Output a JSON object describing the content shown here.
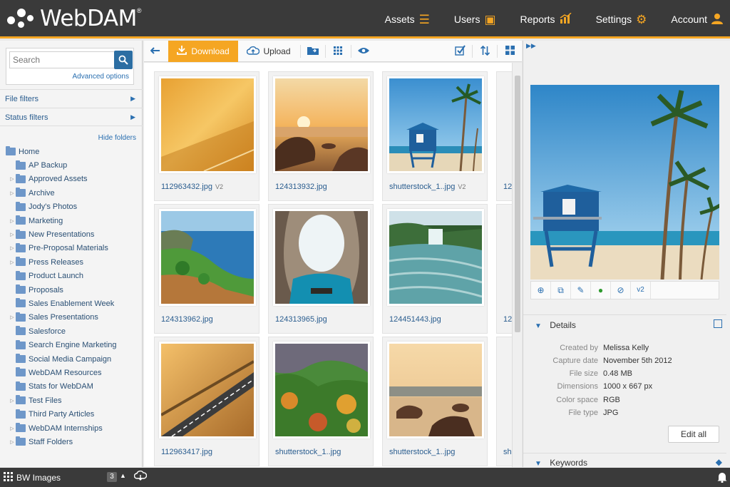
{
  "app": {
    "logo_text": "WebDAM",
    "logo_reg": "®"
  },
  "nav": [
    {
      "label": "Assets",
      "icon": "stack-icon"
    },
    {
      "label": "Users",
      "icon": "contact-card-icon"
    },
    {
      "label": "Reports",
      "icon": "chart-icon"
    },
    {
      "label": "Settings",
      "icon": "gears-icon"
    },
    {
      "label": "Account",
      "icon": "user-icon"
    }
  ],
  "search": {
    "placeholder": "Search",
    "advanced_label": "Advanced options"
  },
  "filters": {
    "file_filters": "File filters",
    "status_filters": "Status filters",
    "hide_folders": "Hide folders"
  },
  "folders": {
    "home": "Home",
    "items": [
      {
        "label": "AP Backup",
        "expandable": false
      },
      {
        "label": "Approved Assets",
        "expandable": true
      },
      {
        "label": "Archive",
        "expandable": true
      },
      {
        "label": "Jody's Photos",
        "expandable": false
      },
      {
        "label": "Marketing",
        "expandable": true
      },
      {
        "label": "New Presentations",
        "expandable": true
      },
      {
        "label": "Pre-Proposal Materials",
        "expandable": true
      },
      {
        "label": "Press Releases",
        "expandable": true
      },
      {
        "label": "Product Launch",
        "expandable": false
      },
      {
        "label": "Proposals",
        "expandable": false
      },
      {
        "label": "Sales Enablement Week",
        "expandable": false
      },
      {
        "label": "Sales Presentations",
        "expandable": true
      },
      {
        "label": "Salesforce",
        "expandable": false
      },
      {
        "label": "Search Engine Marketing",
        "expandable": false
      },
      {
        "label": "Social Media Campaign",
        "expandable": false
      },
      {
        "label": "WebDAM Resources",
        "expandable": false
      },
      {
        "label": "Stats for WebDAM",
        "expandable": false
      },
      {
        "label": "Test Files",
        "expandable": true
      },
      {
        "label": "Third Party Articles",
        "expandable": false
      },
      {
        "label": "WebDAM Internships",
        "expandable": true
      },
      {
        "label": "Staff Folders",
        "expandable": true
      }
    ]
  },
  "toolbar": {
    "download_label": "Download",
    "upload_label": "Upload"
  },
  "assets": [
    {
      "name": "112963432.jpg",
      "version": "V2",
      "scene": "haze"
    },
    {
      "name": "124313932.jpg",
      "version": "",
      "scene": "rocks-sunset"
    },
    {
      "name": "shutterstock_1..jpg",
      "version": "V2",
      "scene": "lifeguard"
    },
    {
      "name": "124313962.jpg",
      "version": "",
      "scene": "coast"
    },
    {
      "name": "124313965.jpg",
      "version": "",
      "scene": "cave"
    },
    {
      "name": "124451443.jpg",
      "version": "",
      "scene": "river"
    },
    {
      "name": "112963417.jpg",
      "version": "",
      "scene": "road"
    },
    {
      "name": "shutterstock_1..jpg",
      "version": "",
      "scene": "valley"
    },
    {
      "name": "shutterstock_1..jpg",
      "version": "",
      "scene": "rocks-sea"
    }
  ],
  "partial_labels": [
    "12",
    "12",
    "sh"
  ],
  "details": {
    "header": "Details",
    "rows": [
      {
        "key": "Created by",
        "value": "Melissa Kelly"
      },
      {
        "key": "Capture date",
        "value": "November 5th 2012"
      },
      {
        "key": "File size",
        "value": "0.48 MB"
      },
      {
        "key": "Dimensions",
        "value": "1000 x 667 px"
      },
      {
        "key": "Color space",
        "value": "RGB"
      },
      {
        "key": "File type",
        "value": "JPG"
      }
    ],
    "edit_all": "Edit all",
    "preview_version": "v2"
  },
  "keywords": {
    "header": "Keywords"
  },
  "bottom": {
    "collection": "BW Images",
    "count": "3"
  },
  "colors": {
    "accent": "#f5a623",
    "link": "#2a6fb0",
    "topbar": "#3a3a3a"
  }
}
